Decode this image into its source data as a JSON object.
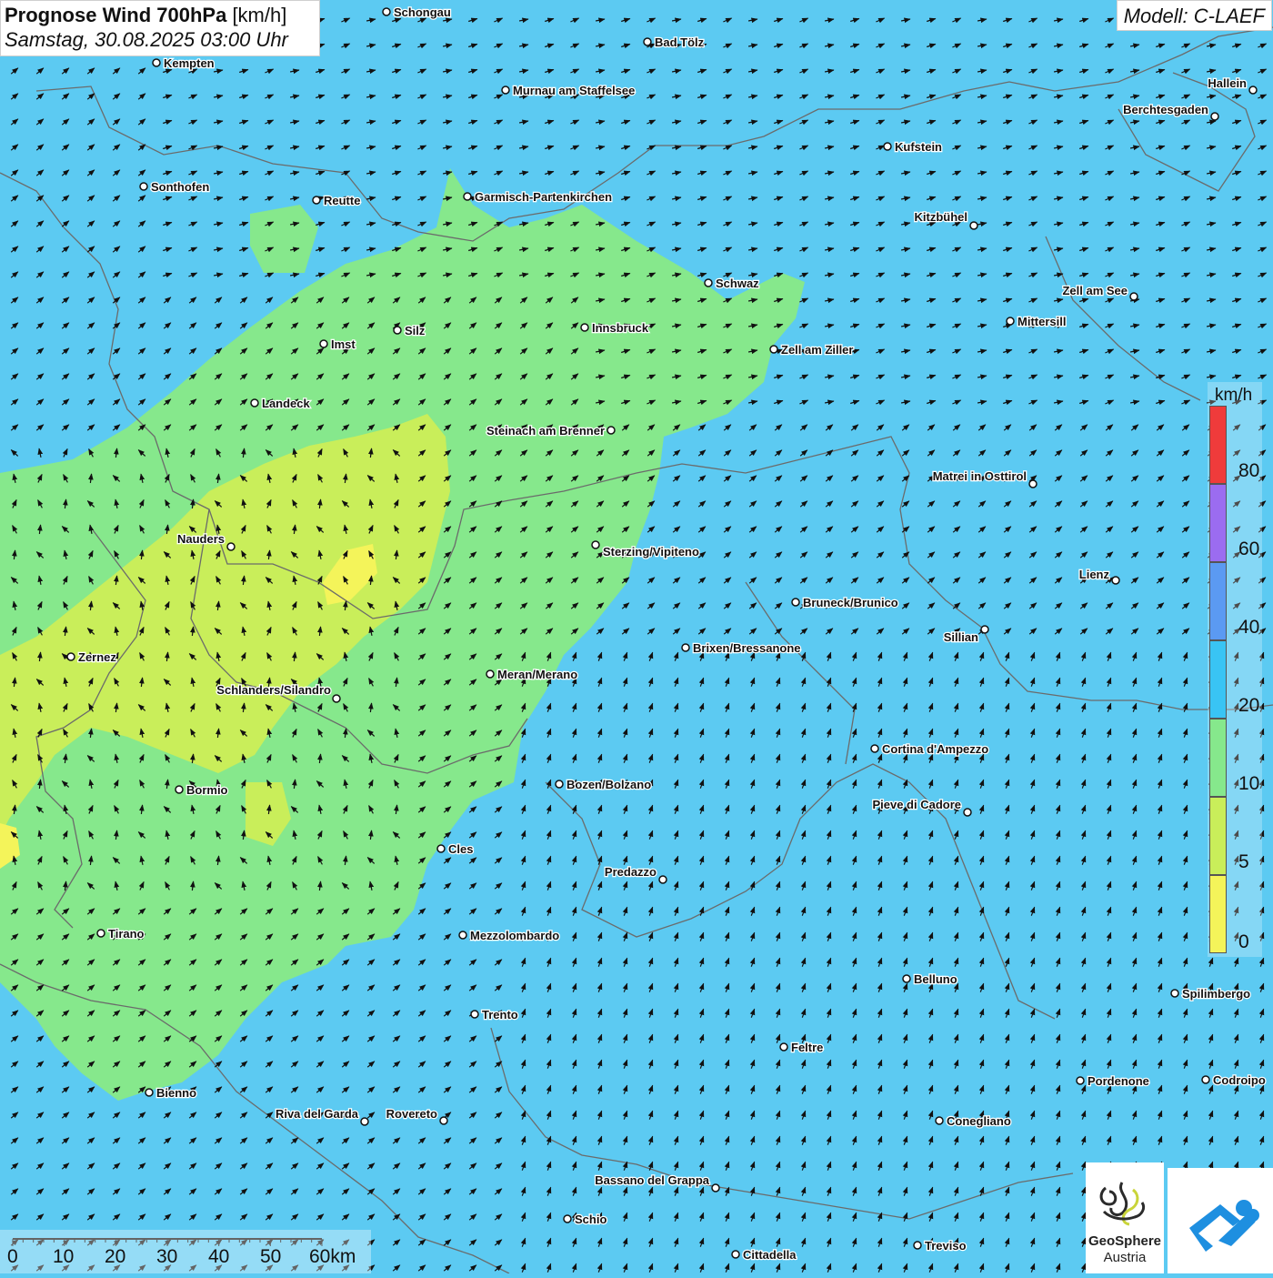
{
  "header": {
    "title_bold": "Prognose Wind 700hPa",
    "title_unit": "[km/h]",
    "datetime": "Samstag, 30.08.2025 03:00 Uhr",
    "model": "Modell: C-LAEF"
  },
  "legend": {
    "unit": "km/h",
    "labels": [
      "80",
      "60",
      "40",
      "20",
      "10",
      "5",
      "0"
    ],
    "colors": [
      "#ef3b3b",
      "#9b6cf0",
      "#5b9af2",
      "#39c4f4",
      "#86e88c",
      "#c9ee5a",
      "#f4f45a"
    ]
  },
  "colors": {
    "wind_0_5": "#f4f45a",
    "wind_5_10": "#c9ee5a",
    "wind_10_20": "#86e88c",
    "wind_20_40": "#5ccaf2",
    "borders": "#6b6b6b"
  },
  "scale_bar": {
    "labels": [
      "0",
      "10",
      "20",
      "30",
      "40",
      "50",
      "60km"
    ]
  },
  "cities": [
    {
      "name": "Schongau"
    },
    {
      "name": "Bad Tölz"
    },
    {
      "name": "Kempten"
    },
    {
      "name": "Murnau am Staffelsee"
    },
    {
      "name": "Hallein"
    },
    {
      "name": "Berchtesgaden"
    },
    {
      "name": "Kufstein"
    },
    {
      "name": "Sonthofen"
    },
    {
      "name": "Reutte"
    },
    {
      "name": "Garmisch-Partenkirchen"
    },
    {
      "name": "Kitzbühel"
    },
    {
      "name": "Schwaz"
    },
    {
      "name": "Zell am See"
    },
    {
      "name": "Mittersill"
    },
    {
      "name": "Innsbruck"
    },
    {
      "name": "Silz"
    },
    {
      "name": "Imst"
    },
    {
      "name": "Zell am Ziller"
    },
    {
      "name": "Landeck"
    },
    {
      "name": "Steinach am Brenner"
    },
    {
      "name": "Matrei in Osttirol"
    },
    {
      "name": "Nauders"
    },
    {
      "name": "Sterzing/Vipiteno"
    },
    {
      "name": "Lienz"
    },
    {
      "name": "Bruneck/Brunico"
    },
    {
      "name": "Sillian"
    },
    {
      "name": "Brixen/Bressanone"
    },
    {
      "name": "Zernez"
    },
    {
      "name": "Meran/Merano"
    },
    {
      "name": "Schlanders/Silandro"
    },
    {
      "name": "Cortina d'Ampezzo"
    },
    {
      "name": "Bozen/Bolzano"
    },
    {
      "name": "Bormio"
    },
    {
      "name": "Pieve di Cadore"
    },
    {
      "name": "Cles"
    },
    {
      "name": "Predazzo"
    },
    {
      "name": "Tirano"
    },
    {
      "name": "Mezzolombardo"
    },
    {
      "name": "Belluno"
    },
    {
      "name": "Spilimbergo"
    },
    {
      "name": "Trento"
    },
    {
      "name": "Feltre"
    },
    {
      "name": "Pordenone"
    },
    {
      "name": "Codroipo"
    },
    {
      "name": "Bienno"
    },
    {
      "name": "Riva del Garda"
    },
    {
      "name": "Rovereto"
    },
    {
      "name": "Conegliano"
    },
    {
      "name": "Bassano del Grappa"
    },
    {
      "name": "Schio"
    },
    {
      "name": "Treviso"
    },
    {
      "name": "Cittadella"
    }
  ],
  "logos": {
    "geosphere_line1": "GeoSphere",
    "geosphere_line2": "Austria"
  }
}
